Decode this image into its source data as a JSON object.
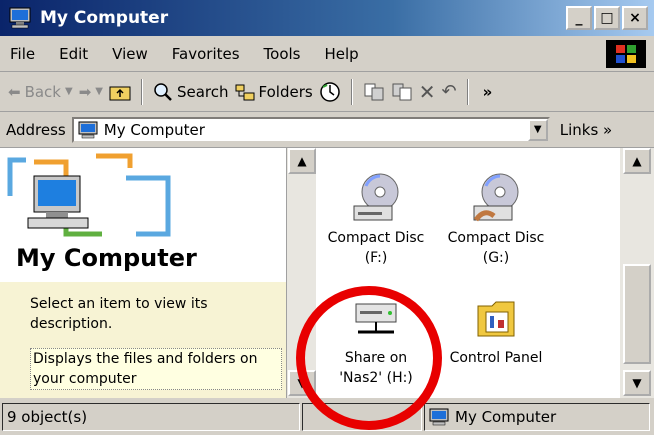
{
  "window": {
    "title": "My Computer",
    "controls": [
      "_",
      "□",
      "×"
    ]
  },
  "menu": [
    "File",
    "Edit",
    "View",
    "Favorites",
    "Tools",
    "Help"
  ],
  "toolbar": {
    "back": "Back",
    "search": "Search",
    "folders": "Folders",
    "overflow": "»"
  },
  "address": {
    "label": "Address",
    "value": "My Computer",
    "links": "Links »"
  },
  "left_pane": {
    "heading": "My Computer",
    "description": "Select an item to view its description.",
    "tooltip": "Displays the files and folders on your computer"
  },
  "items": [
    {
      "label_line1": "Compact Disc",
      "label_line2": "(F:)",
      "icon": "cd-drive-icon"
    },
    {
      "label_line1": "Compact Disc",
      "label_line2": "(G:)",
      "icon": "cd-drive-icon"
    },
    {
      "label_line1": "Share on",
      "label_line2": "'Nas2' (H:)",
      "icon": "network-drive-icon"
    },
    {
      "label_line1": "Control Panel",
      "label_line2": "",
      "icon": "control-panel-icon"
    }
  ],
  "status": {
    "count": "9 object(s)",
    "location": "My Computer"
  },
  "colors": {
    "highlight_circle": "#e80000",
    "title_bar": "#0a246a"
  }
}
